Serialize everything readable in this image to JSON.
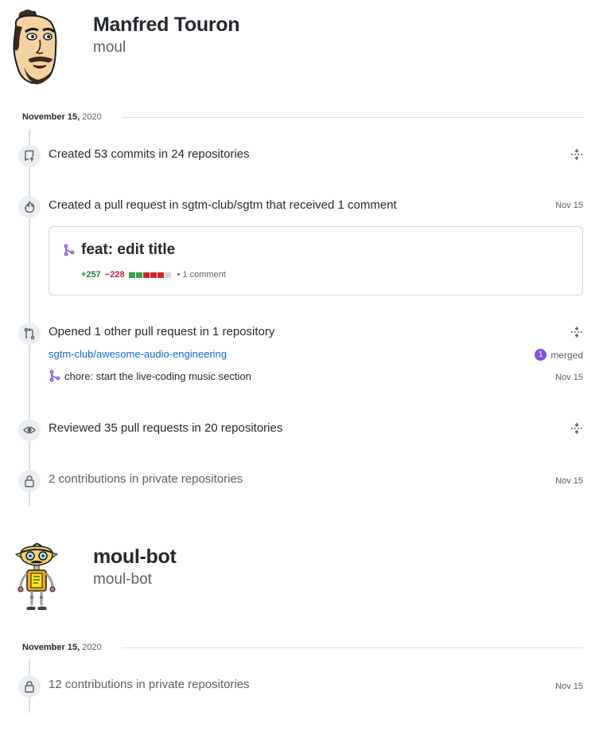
{
  "profiles": [
    {
      "name": "Manfred Touron",
      "login": "moul",
      "date_month": "November 15,",
      "date_year": "2020",
      "events": {
        "commits": {
          "text": "Created 53 commits in 24 repositories"
        },
        "pull_request": {
          "text": "Created a pull request in sgtm-club/sgtm that received 1 comment",
          "date": "Nov 15",
          "card": {
            "title": "feat: edit title",
            "additions": "+257",
            "deletions": "−228",
            "diffstat_colors": [
              "#2da44e",
              "#2da44e",
              "#cf222e",
              "#cf222e",
              "#cf222e",
              "#d0d7de"
            ],
            "separator": "•",
            "comments": "1 comment"
          }
        },
        "opened": {
          "text": "Opened 1 other pull request in 1 repository",
          "repo": "sgtm-club/awesome-audio-engineering",
          "merged_count": "1",
          "merged_label": "merged",
          "pr_title": "chore: start the live-coding music section",
          "pr_date": "Nov 15"
        },
        "reviewed": {
          "text": "Reviewed 35 pull requests in 20 repositories"
        },
        "private": {
          "text": "2 contributions in private repositories",
          "date": "Nov 15"
        }
      }
    },
    {
      "name": "moul-bot",
      "login": "moul-bot",
      "date_month": "November 15,",
      "date_year": "2020",
      "events": {
        "private": {
          "text": "12 contributions in private repositories",
          "date": "Nov 15"
        }
      }
    }
  ],
  "colors": {
    "accent_purple": "#8250df",
    "link_blue": "#0969da",
    "add_green": "#1a7f37",
    "del_red": "#cf222e"
  },
  "icons": {
    "commits": "repo-push-icon",
    "pull_request": "flame-icon",
    "opened": "git-compare-icon",
    "reviewed": "eye-icon",
    "private": "lock-icon",
    "pr_card": "git-pull-request-icon",
    "expand": "fold-icon"
  }
}
